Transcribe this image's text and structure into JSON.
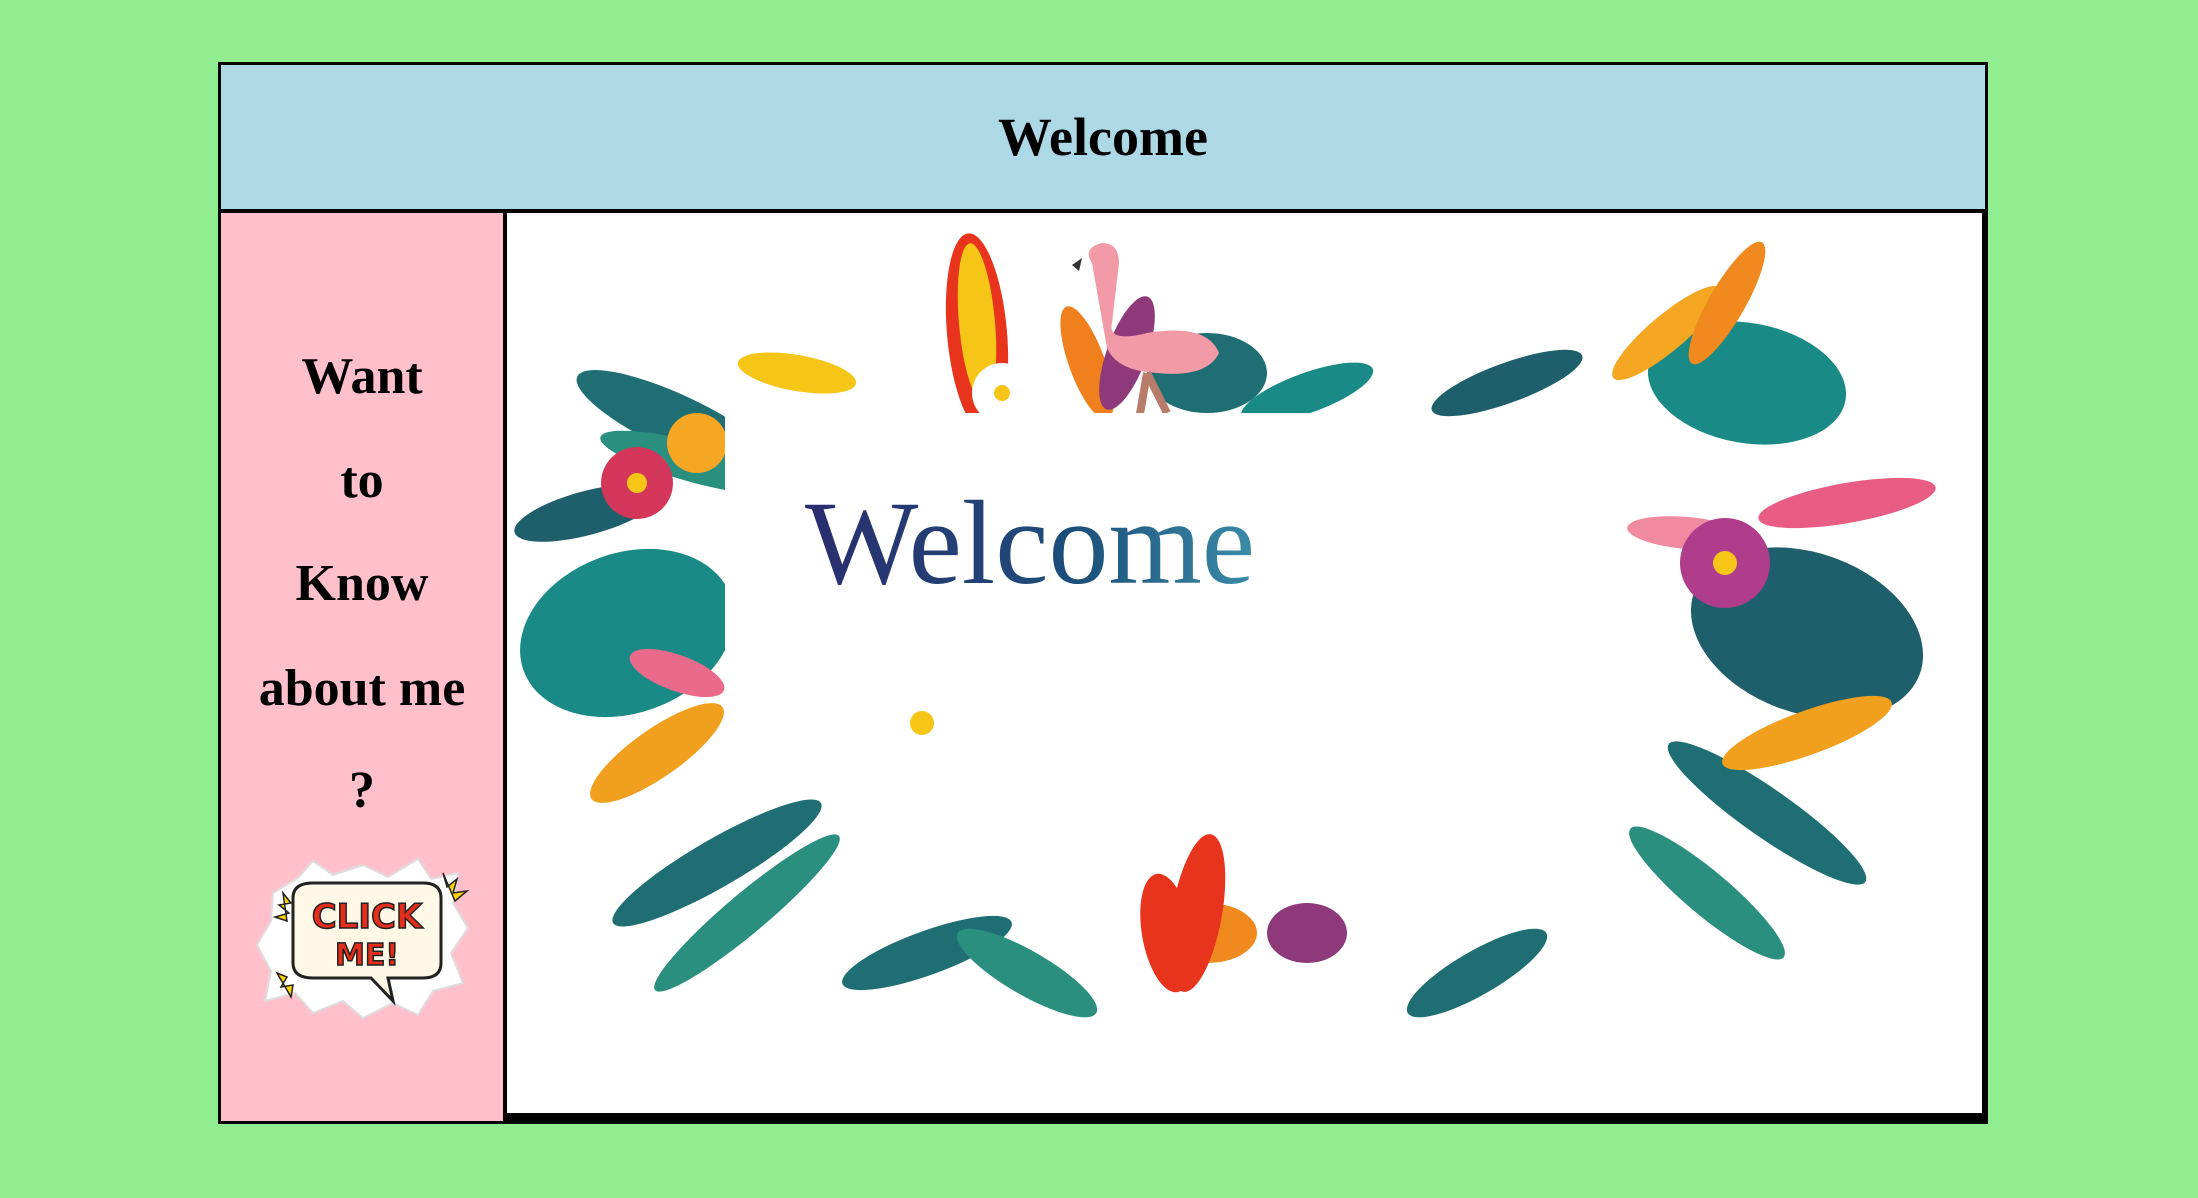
{
  "header": {
    "title": "Welcome"
  },
  "sidebar": {
    "lines": [
      "Want",
      "to",
      "Know",
      "about me",
      "?"
    ],
    "click_button": {
      "line1": "CLICK",
      "line2": "ME!"
    }
  },
  "main": {
    "banner_text": "Welcome"
  },
  "colors": {
    "page_background": "#90ee90",
    "header_background": "#add8e6",
    "sidebar_background": "#ffc0cb",
    "main_background": "#ffffff",
    "border": "#000000"
  }
}
